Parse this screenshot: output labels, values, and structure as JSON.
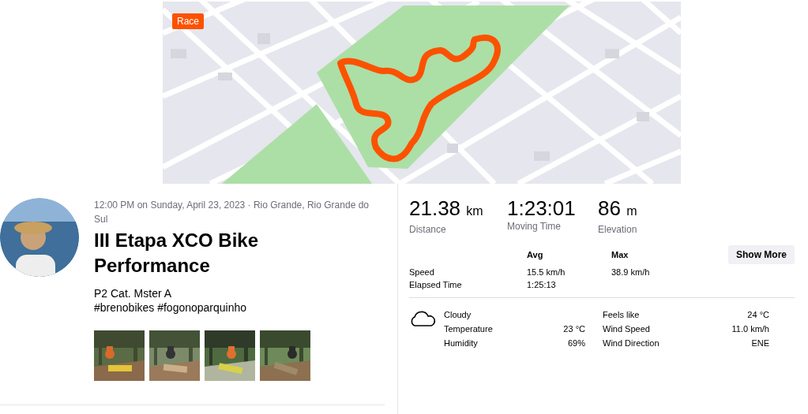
{
  "map": {
    "badge": "Race",
    "kind": "picture"
  },
  "activity": {
    "date_location": "12:00 PM on Sunday, April 23, 2023 · Rio Grande, Rio Grande do Sul",
    "title": "III Etapa XCO Bike Performance",
    "description": [
      "P2 Cat. Mster A",
      "#brenobikes #fogonoparquinho"
    ],
    "photos": [
      {
        "kind": "picture"
      },
      {
        "kind": "picture"
      },
      {
        "kind": "picture"
      },
      {
        "kind": "picture"
      }
    ]
  },
  "stats": [
    {
      "value": "21.38",
      "unit": "km",
      "label": "Distance"
    },
    {
      "value": "1:23:01",
      "label": "Moving Time"
    },
    {
      "value": "86",
      "unit": "m",
      "label": "Elevation"
    }
  ],
  "details": {
    "columns": [
      "Avg",
      "Max"
    ],
    "rows": [
      {
        "label": "Speed",
        "values": [
          "15.5 km/h",
          "38.9 km/h"
        ]
      },
      {
        "label": "Elapsed Time",
        "values": [
          "1:25:13"
        ]
      }
    ],
    "button": "Show More"
  },
  "weather": {
    "condition": "Cloudy",
    "left": [
      {
        "label": "Temperature",
        "value": "23 °C"
      },
      {
        "label": "Humidity",
        "value": "69%"
      }
    ],
    "right": [
      {
        "label": "Feels like",
        "value": "24 °C"
      },
      {
        "label": "Wind Speed",
        "value": "11.0 km/h"
      },
      {
        "label": "Wind Direction",
        "value": "ENE"
      }
    ]
  }
}
